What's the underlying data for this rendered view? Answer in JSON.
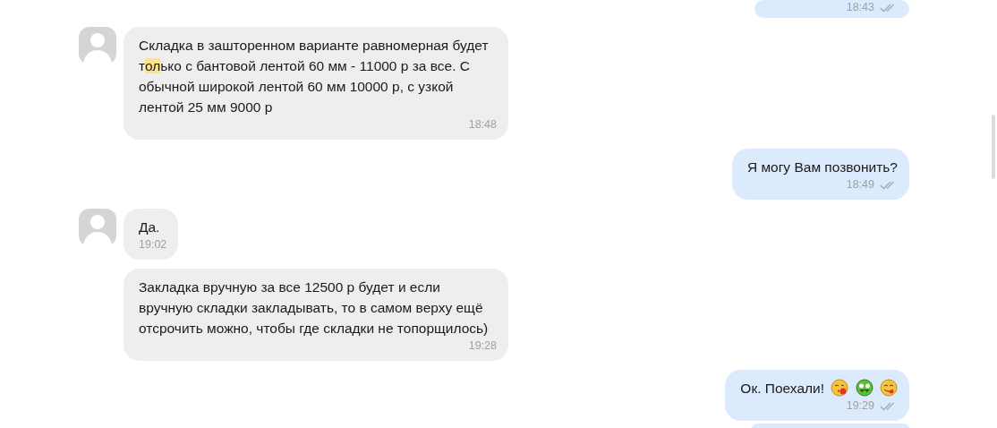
{
  "messages": [
    {
      "kind": "outgoing",
      "time": "18:43",
      "read": true
    },
    {
      "kind": "incoming",
      "avatar": true,
      "parts": [
        {
          "text": "Складка в зашторенном варианте равномерная будет т",
          "highlight": false
        },
        {
          "text": "ол",
          "highlight": true
        },
        {
          "text": "ько с бантовой лентой 60 мм  - 11000 р за все. С обычной широкой лентой 60 мм 10000 р, с узкой лентой 25 мм 9000 р",
          "highlight": false
        }
      ],
      "time": "18:48"
    },
    {
      "kind": "outgoing",
      "parts": [
        {
          "text": "Я могу Вам позвонить?",
          "highlight": false
        }
      ],
      "time": "18:49",
      "read": true
    },
    {
      "kind": "incoming",
      "avatar": true,
      "parts": [
        {
          "text": "Да.",
          "highlight": false
        }
      ],
      "time": "19:02"
    },
    {
      "kind": "incoming",
      "avatar": false,
      "parts": [
        {
          "text": "Закладка вручную за все 12500 р будет и если вручную складки закладывать, то в самом верху ещё отсрочить можно, чтобы где складки не топорщилось)",
          "highlight": false
        }
      ],
      "time": "19:28"
    },
    {
      "kind": "outgoing",
      "parts": [
        {
          "text": "Ок. Поехали!",
          "highlight": false
        }
      ],
      "emojis": [
        {
          "kind": "kiss"
        },
        {
          "kind": "money"
        },
        {
          "kind": "yum"
        }
      ],
      "time": "19:29",
      "read": true
    },
    {
      "kind": "outgoing"
    }
  ]
}
